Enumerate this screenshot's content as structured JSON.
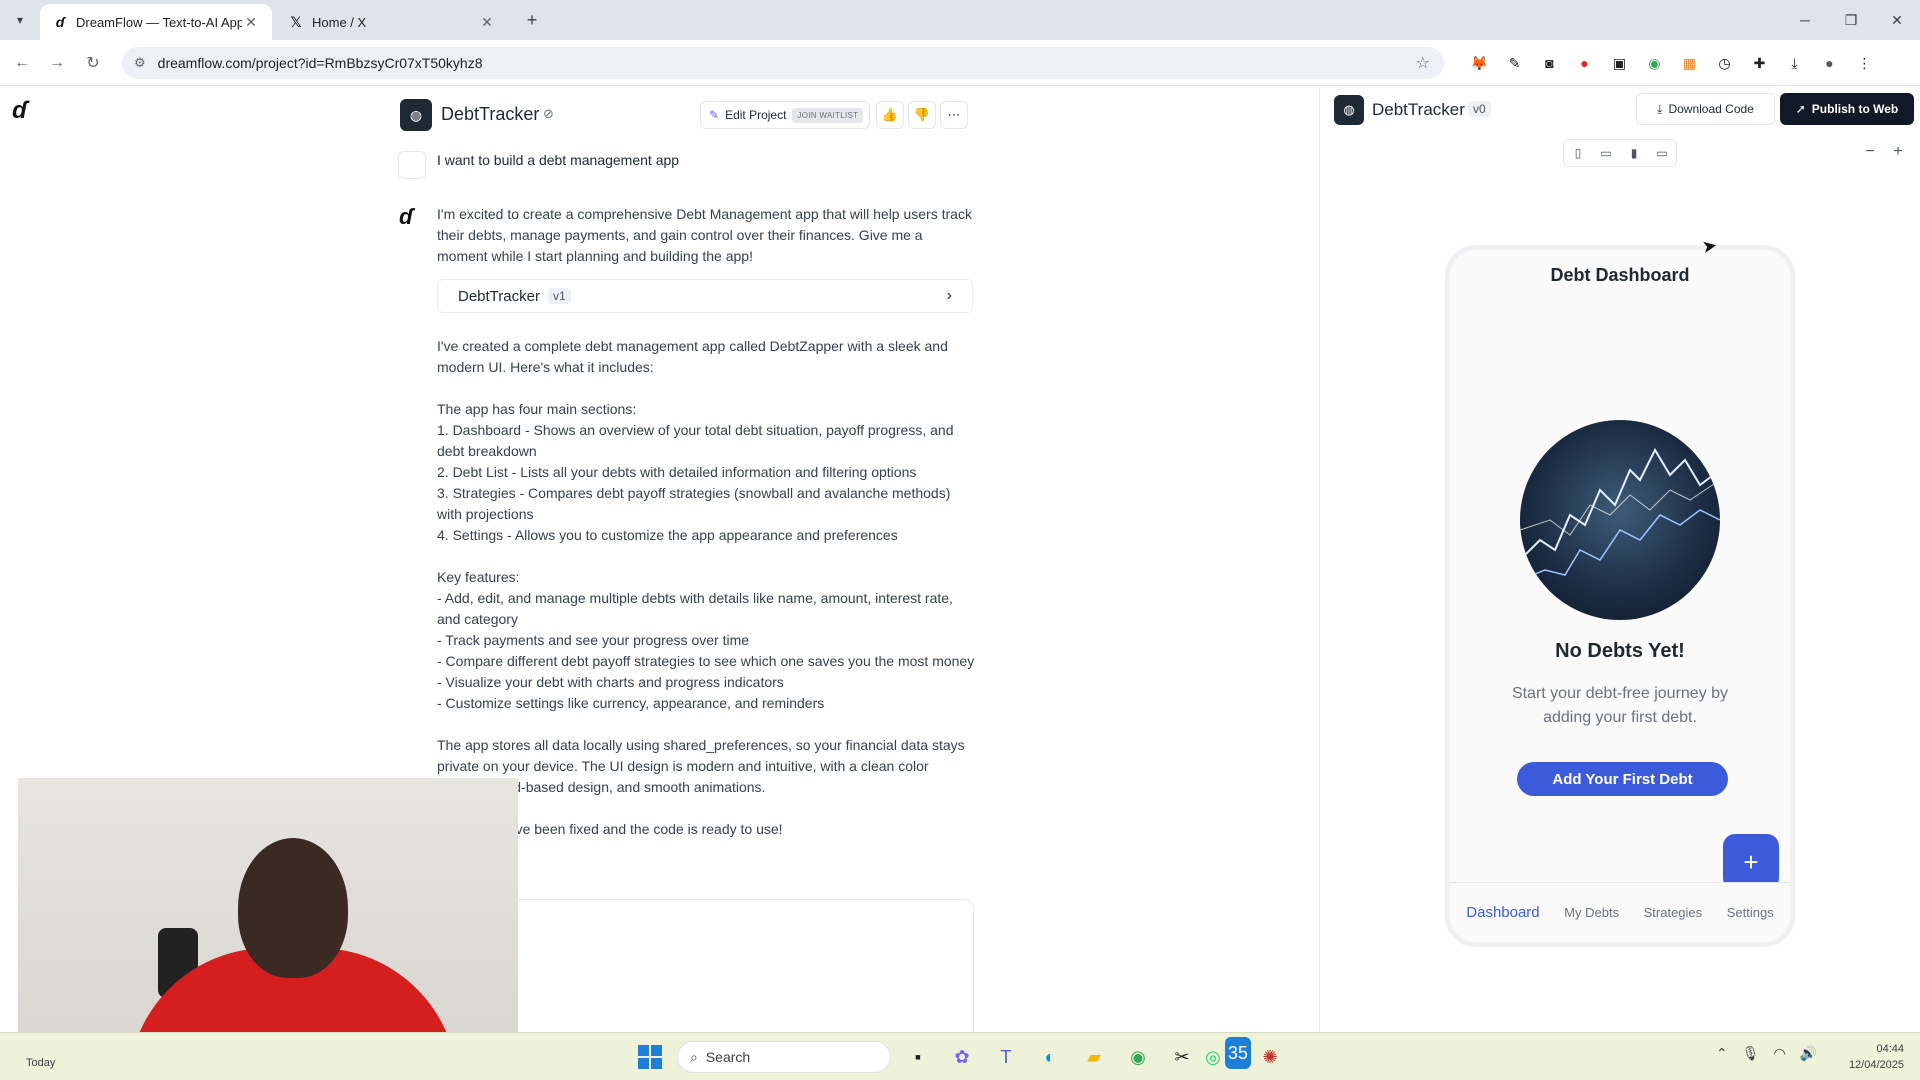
{
  "browser": {
    "tabs": [
      {
        "title": "DreamFlow — Text-to-AI App B",
        "favicon": "dreamflow-icon",
        "active": true
      },
      {
        "title": "Home / X",
        "favicon": "x-icon",
        "active": false
      }
    ],
    "url": "dreamflow.com/project?id=RmBbzsyCr07xT50kyhz8"
  },
  "chat_header": {
    "project_name": "DebtTracker",
    "edit_project_label": "Edit Project",
    "waitlist_label": "JOIN WAITLIST"
  },
  "chat": {
    "user_message": "I want to build a debt management app",
    "ai_intro": "I'm excited to create a comprehensive Debt Management app that will help users track their debts, manage payments, and gain control over their finances. Give me a moment while I start planning and building the app!",
    "version_card": {
      "name": "DebtTracker",
      "version": "v1"
    },
    "ai_summary": "I've created a complete debt management app called DebtZapper with a sleek and modern UI. Here's what it includes:\n\nThe app has four main sections:\n1. Dashboard - Shows an overview of your total debt situation, payoff progress, and debt breakdown\n2. Debt List - Lists all your debts with detailed information and filtering options\n3. Strategies - Compares debt payoff strategies (snowball and avalanche methods) with projections\n4. Settings - Allows you to customize the app appearance and preferences\n\nKey features:\n- Add, edit, and manage multiple debts with details like name, amount, interest rate, and category\n- Track payments and see your progress over time\n- Compare different debt payoff strategies to see which one saves you the most money\n- Visualize your debt with charts and progress indicators\n- Customize settings like currency, appearance, and reminders\n\nThe app stores all data locally using shared_preferences, so your financial data stays private on your device. The UI design is modern and intuitive, with a clean color scheme, card-based design, and smooth animations.\n\nAll issues have been fixed and the code is ready to use!"
  },
  "preview": {
    "project_name": "DebtTracker",
    "version": "v0",
    "download_label": "Download Code",
    "publish_label": "Publish to Web",
    "phone": {
      "title": "Debt Dashboard",
      "empty_title": "No Debts Yet!",
      "empty_subtitle": "Start your debt-free journey by adding your first debt.",
      "add_button": "Add Your First Debt",
      "fab": "+",
      "nav": [
        {
          "label": "Dashboard",
          "active": true
        },
        {
          "label": "My Debts",
          "active": false
        },
        {
          "label": "Strategies",
          "active": false
        },
        {
          "label": "Settings",
          "active": false
        }
      ]
    }
  },
  "taskbar": {
    "weather": "Today",
    "search_placeholder": "Search",
    "whatsapp_badge": "35",
    "time": "04:44",
    "date": "12/04/2025"
  },
  "colors": {
    "accent": "#3b5bdb",
    "publish_bg": "#111827",
    "webcam_shirt": "#d51f1f"
  }
}
